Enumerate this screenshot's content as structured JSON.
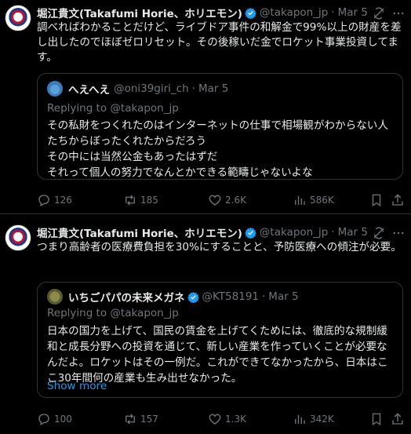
{
  "tweets": [
    {
      "author_name": "堀江貴文(Takafumi Horie、ホリエモン)",
      "handle": "@takapon_jp",
      "sep": "·",
      "date": "Mar 5",
      "text": "調べればわかることだけど、ライブドア事件の和解金で99%以上の財産を差し出したのでほぼゼロリセット。その後稼いだ金でロケット事業投資してます。",
      "quote": {
        "author_name": "へえへえ",
        "handle": "@oni39giri_ch",
        "sep": "·",
        "date": "Mar 5",
        "replying_to": "Replying to @takapon_jp",
        "text": "その私財をつくれたのはインターネットの仕事で相場観がわからない人たちからぼったくれたからだろう\nその中には当然公金もあったはずだ\nそれって個人の努力でなんとかできる範疇じゃないよな"
      },
      "stats": {
        "replies": "126",
        "reposts": "185",
        "likes": "2.6K",
        "views": "586K"
      }
    },
    {
      "author_name": "堀江貴文(Takafumi Horie、ホリエモン)",
      "handle": "@takapon_jp",
      "sep": "·",
      "date": "Mar 5",
      "text": "つまり高齢者の医療費負担を30%にすることと、予防医療への傾注が必要。",
      "quote": {
        "author_name": "いちごパパの未来メガネ",
        "handle": "@KT58191",
        "sep": "·",
        "date": "Mar 5",
        "replying_to": "Replying to @takapon_jp",
        "text": "日本の国力を上げて、国民の賃金を上げてくためには、徹底的な規制緩和と成長分野への投資を通じて、新しい産業を作っていくことが必要なんだよ。ロケットはその一例だ。これができてなかったから、日本はここ30年間何の産業も生み出せなかった。",
        "show_more": "Show more"
      },
      "stats": {
        "replies": "100",
        "reposts": "157",
        "likes": "1.3K",
        "views": "342K"
      }
    }
  ],
  "colors": {
    "accent": "#1d9bf0",
    "muted": "#71767b",
    "text": "#e7e9ea",
    "border": "#2f3336",
    "bg": "#000000"
  },
  "icons": [
    "grok-icon",
    "more-icon",
    "verified-icon",
    "reply-icon",
    "repost-icon",
    "like-icon",
    "views-icon",
    "bookmark-icon",
    "share-icon"
  ]
}
